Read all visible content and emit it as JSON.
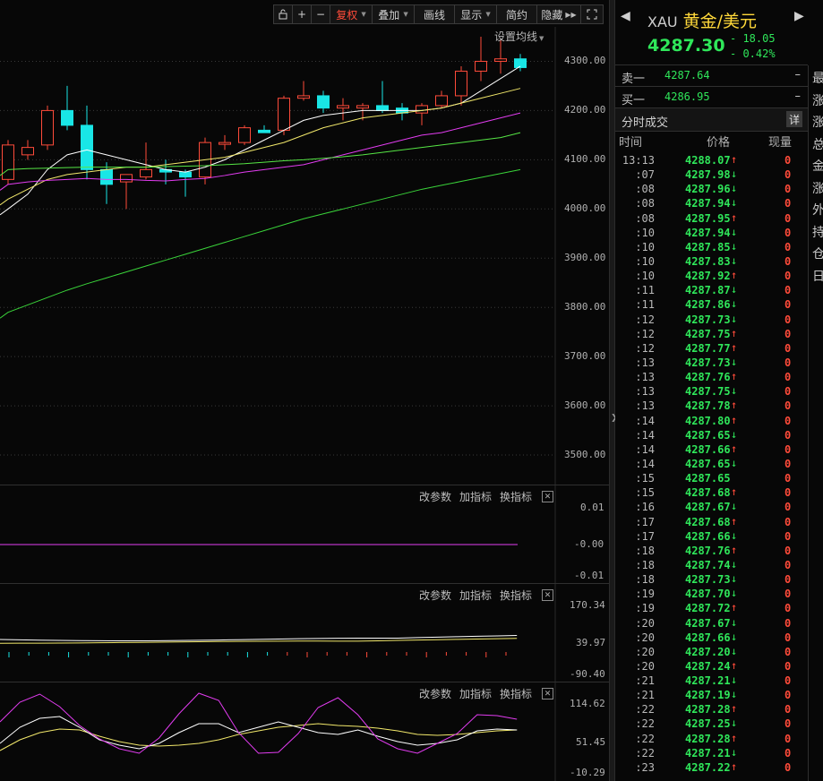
{
  "toolbar": {
    "lock_icon": "lock-icon",
    "zoom_in": "+",
    "zoom_out": "−",
    "adjust": "复权",
    "overlay": "叠加",
    "draw": "画线",
    "display": "显示",
    "simple": "简约",
    "hide": "隐藏",
    "fullscreen_icon": "fullscreen-icon"
  },
  "main_chart": {
    "set_ma_label": "设置均线",
    "price_ticks": [
      "4300.00",
      "4200.00",
      "4100.00",
      "4000.00",
      "3900.00",
      "3800.00",
      "3700.00",
      "3600.00",
      "3500.00"
    ],
    "price_range": [
      3440,
      4370
    ],
    "candles": [
      {
        "o": 4060,
        "h": 4140,
        "l": 4050,
        "c": 4130
      },
      {
        "o": 4110,
        "h": 4140,
        "l": 4100,
        "c": 4125
      },
      {
        "o": 4130,
        "h": 4210,
        "l": 4120,
        "c": 4200
      },
      {
        "o": 4200,
        "h": 4250,
        "l": 4160,
        "c": 4170
      },
      {
        "o": 4170,
        "h": 4210,
        "l": 4060,
        "c": 4080
      },
      {
        "o": 4080,
        "h": 4095,
        "l": 4010,
        "c": 4050
      },
      {
        "o": 4055,
        "h": 4070,
        "l": 4000,
        "c": 4070
      },
      {
        "o": 4065,
        "h": 4135,
        "l": 4060,
        "c": 4080
      },
      {
        "o": 4080,
        "h": 4100,
        "l": 4050,
        "c": 4075
      },
      {
        "o": 4075,
        "h": 4080,
        "l": 4025,
        "c": 4065
      },
      {
        "o": 4065,
        "h": 4145,
        "l": 4050,
        "c": 4135
      },
      {
        "o": 4135,
        "h": 4150,
        "l": 4120,
        "c": 4135
      },
      {
        "o": 4135,
        "h": 4170,
        "l": 4130,
        "c": 4165
      },
      {
        "o": 4160,
        "h": 4170,
        "l": 4155,
        "c": 4155
      },
      {
        "o": 4160,
        "h": 4230,
        "l": 4150,
        "c": 4225
      },
      {
        "o": 4225,
        "h": 4260,
        "l": 4220,
        "c": 4230
      },
      {
        "o": 4230,
        "h": 4240,
        "l": 4195,
        "c": 4205
      },
      {
        "o": 4205,
        "h": 4225,
        "l": 4180,
        "c": 4210
      },
      {
        "o": 4205,
        "h": 4215,
        "l": 4180,
        "c": 4210
      },
      {
        "o": 4210,
        "h": 4260,
        "l": 4195,
        "c": 4200
      },
      {
        "o": 4205,
        "h": 4215,
        "l": 4180,
        "c": 4195
      },
      {
        "o": 4195,
        "h": 4215,
        "l": 4170,
        "c": 4210
      },
      {
        "o": 4210,
        "h": 4240,
        "l": 4205,
        "c": 4230
      },
      {
        "o": 4230,
        "h": 4290,
        "l": 4210,
        "c": 4280
      },
      {
        "o": 4280,
        "h": 4350,
        "l": 4260,
        "c": 4300
      },
      {
        "o": 4300,
        "h": 4345,
        "l": 4275,
        "c": 4305
      },
      {
        "o": 4305,
        "h": 4315,
        "l": 4280,
        "c": 4287.3
      }
    ],
    "ma_lines": [
      {
        "color": "#ffffff",
        "values": [
          4000,
          4030,
          4080,
          4110,
          4120,
          4110,
          4100,
          4090,
          4080,
          4075,
          4085,
          4100,
          4120,
          4140,
          4160,
          4180,
          4190,
          4195,
          4200,
          4200,
          4200,
          4200,
          4205,
          4215,
          4240,
          4265,
          4290
        ]
      },
      {
        "color": "#f2e86b",
        "values": [
          4020,
          4040,
          4060,
          4070,
          4075,
          4080,
          4085,
          4085,
          4090,
          4095,
          4100,
          4105,
          4115,
          4125,
          4135,
          4150,
          4165,
          4175,
          4185,
          4190,
          4195,
          4200,
          4205,
          4215,
          4225,
          4235,
          4245
        ]
      },
      {
        "color": "#e23cf0",
        "values": [
          4050,
          4055,
          4058,
          4060,
          4062,
          4060,
          4060,
          4058,
          4057,
          4060,
          4062,
          4068,
          4075,
          4080,
          4085,
          4090,
          4100,
          4110,
          4120,
          4130,
          4140,
          4150,
          4155,
          4165,
          4175,
          4185,
          4195
        ]
      },
      {
        "color": "#56e645",
        "values": [
          4080,
          4082,
          4083,
          4084,
          4085,
          4085,
          4085,
          4085,
          4086,
          4087,
          4088,
          4090,
          4092,
          4095,
          4098,
          4100,
          4103,
          4106,
          4110,
          4115,
          4120,
          4125,
          4130,
          4135,
          4140,
          4145,
          4155
        ]
      },
      {
        "color": "#3ad43a",
        "values": [
          3790,
          3805,
          3820,
          3835,
          3848,
          3860,
          3872,
          3884,
          3896,
          3908,
          3920,
          3932,
          3944,
          3956,
          3968,
          3980,
          3990,
          4000,
          4010,
          4020,
          4030,
          4040,
          4048,
          4056,
          4064,
          4072,
          4080
        ]
      }
    ]
  },
  "panels": [
    {
      "buttons": [
        "改参数",
        "加指标",
        "换指标"
      ],
      "ticks": [
        "0.01",
        "-0.00",
        "-0.01"
      ]
    },
    {
      "buttons": [
        "改参数",
        "加指标",
        "换指标"
      ],
      "ticks": [
        "170.34",
        "39.97",
        "-90.40"
      ]
    },
    {
      "buttons": [
        "改参数",
        "加指标",
        "换指标"
      ],
      "ticks": [
        "114.62",
        "51.45",
        "-10.29"
      ]
    }
  ],
  "quote": {
    "symbol": "XAU",
    "name": "黄金/美元",
    "last": "4287.30",
    "change_abs": "- 18.05",
    "change_pct": "- 0.42%",
    "sell_label": "卖一",
    "sell_price": "4287.64",
    "buy_label": "买一",
    "buy_price": "4286.95",
    "dash": "–",
    "trades_title": "分时成交",
    "detail_label": "详",
    "col_time": "时间",
    "col_price": "价格",
    "col_vol": "现量",
    "colors": {
      "up": "#ff4b3a",
      "down": "#2fe65a",
      "gold": "#ffd83a"
    }
  },
  "trades": [
    {
      "t": "13:13",
      "p": "4288.07",
      "d": "up",
      "v": "0"
    },
    {
      "t": ":07",
      "p": "4287.98",
      "d": "down",
      "v": "0"
    },
    {
      "t": ":08",
      "p": "4287.96",
      "d": "down",
      "v": "0"
    },
    {
      "t": ":08",
      "p": "4287.94",
      "d": "down",
      "v": "0"
    },
    {
      "t": ":08",
      "p": "4287.95",
      "d": "up",
      "v": "0"
    },
    {
      "t": ":10",
      "p": "4287.94",
      "d": "down",
      "v": "0"
    },
    {
      "t": ":10",
      "p": "4287.85",
      "d": "down",
      "v": "0"
    },
    {
      "t": ":10",
      "p": "4287.83",
      "d": "down",
      "v": "0"
    },
    {
      "t": ":10",
      "p": "4287.92",
      "d": "up",
      "v": "0"
    },
    {
      "t": ":11",
      "p": "4287.87",
      "d": "down",
      "v": "0"
    },
    {
      "t": ":11",
      "p": "4287.86",
      "d": "down",
      "v": "0"
    },
    {
      "t": ":12",
      "p": "4287.73",
      "d": "down",
      "v": "0"
    },
    {
      "t": ":12",
      "p": "4287.75",
      "d": "up",
      "v": "0"
    },
    {
      "t": ":12",
      "p": "4287.77",
      "d": "up",
      "v": "0"
    },
    {
      "t": ":13",
      "p": "4287.73",
      "d": "down",
      "v": "0"
    },
    {
      "t": ":13",
      "p": "4287.76",
      "d": "up",
      "v": "0"
    },
    {
      "t": ":13",
      "p": "4287.75",
      "d": "down",
      "v": "0"
    },
    {
      "t": ":13",
      "p": "4287.78",
      "d": "up",
      "v": "0"
    },
    {
      "t": ":14",
      "p": "4287.80",
      "d": "up",
      "v": "0"
    },
    {
      "t": ":14",
      "p": "4287.65",
      "d": "down",
      "v": "0"
    },
    {
      "t": ":14",
      "p": "4287.66",
      "d": "up",
      "v": "0"
    },
    {
      "t": ":14",
      "p": "4287.65",
      "d": "down",
      "v": "0"
    },
    {
      "t": ":15",
      "p": "4287.65",
      "d": "",
      "v": "0"
    },
    {
      "t": ":15",
      "p": "4287.68",
      "d": "up",
      "v": "0"
    },
    {
      "t": ":16",
      "p": "4287.67",
      "d": "down",
      "v": "0"
    },
    {
      "t": ":17",
      "p": "4287.68",
      "d": "up",
      "v": "0"
    },
    {
      "t": ":17",
      "p": "4287.66",
      "d": "down",
      "v": "0"
    },
    {
      "t": ":18",
      "p": "4287.76",
      "d": "up",
      "v": "0"
    },
    {
      "t": ":18",
      "p": "4287.74",
      "d": "down",
      "v": "0"
    },
    {
      "t": ":18",
      "p": "4287.73",
      "d": "down",
      "v": "0"
    },
    {
      "t": ":19",
      "p": "4287.70",
      "d": "down",
      "v": "0"
    },
    {
      "t": ":19",
      "p": "4287.72",
      "d": "up",
      "v": "0"
    },
    {
      "t": ":20",
      "p": "4287.67",
      "d": "down",
      "v": "0"
    },
    {
      "t": ":20",
      "p": "4287.66",
      "d": "down",
      "v": "0"
    },
    {
      "t": ":20",
      "p": "4287.20",
      "d": "down",
      "v": "0"
    },
    {
      "t": ":20",
      "p": "4287.24",
      "d": "up",
      "v": "0"
    },
    {
      "t": ":21",
      "p": "4287.21",
      "d": "down",
      "v": "0"
    },
    {
      "t": ":21",
      "p": "4287.19",
      "d": "down",
      "v": "0"
    },
    {
      "t": ":22",
      "p": "4287.28",
      "d": "up",
      "v": "0"
    },
    {
      "t": ":22",
      "p": "4287.25",
      "d": "down",
      "v": "0"
    },
    {
      "t": ":22",
      "p": "4287.28",
      "d": "up",
      "v": "0"
    },
    {
      "t": ":22",
      "p": "4287.21",
      "d": "down",
      "v": "0"
    },
    {
      "t": ":23",
      "p": "4287.22",
      "d": "up",
      "v": "0"
    }
  ],
  "info_strip": [
    "最",
    "涨",
    "涨",
    "总",
    "金",
    "涨",
    "外",
    "持",
    "仓",
    "日"
  ]
}
